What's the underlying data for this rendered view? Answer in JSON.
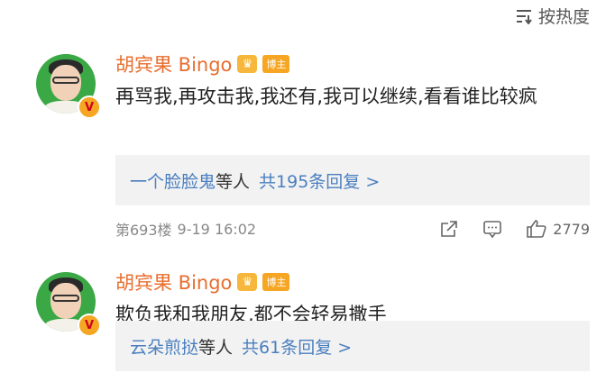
{
  "sort": {
    "label": "按热度"
  },
  "comments": [
    {
      "author": "胡宾果 Bingo",
      "tag": "博主",
      "badge": "V",
      "crown": "♛",
      "text": "再骂我,再攻击我,我还有,我可以继续,看看谁比较疯",
      "replies": {
        "names": "一个脸脸鬼",
        "mid": "等人",
        "count": "共195条回复 >"
      },
      "floor": "第693楼",
      "time": "9-19 16:02",
      "likes": "2779"
    },
    {
      "author": "胡宾果 Bingo",
      "tag": "博主",
      "badge": "V",
      "crown": "♛",
      "text": "欺负我和我朋友,都不会轻易撒手",
      "replies": {
        "names": "云朵煎挞",
        "mid": "等人",
        "count": "共61条回复 >"
      }
    }
  ]
}
